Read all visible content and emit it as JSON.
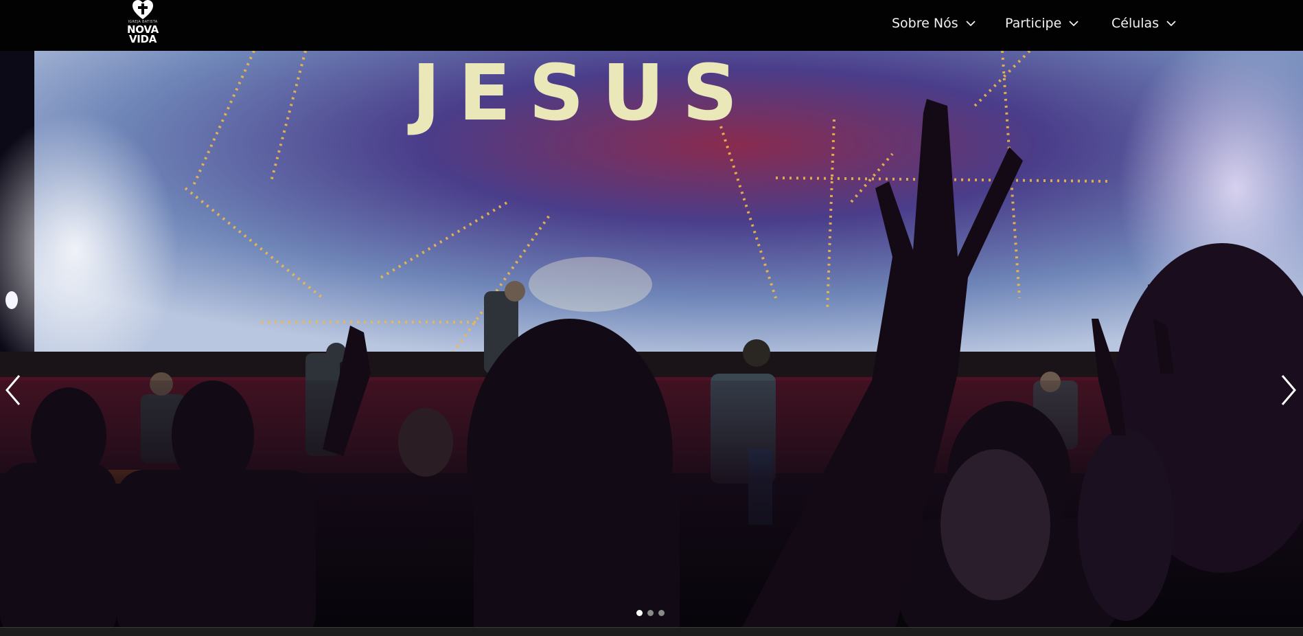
{
  "header": {
    "logo": {
      "tagline": "Igreja Batista",
      "line1": "NOVA",
      "line2": "VIDA"
    },
    "nav": [
      {
        "label": "Sobre Nós"
      },
      {
        "label": "Participe"
      },
      {
        "label": "Células"
      }
    ]
  },
  "hero": {
    "slide_image_text": "JESUS",
    "slide_count": 3,
    "active_slide": 1
  },
  "colors": {
    "header_bg": "#020202",
    "nav_text": "#f2f2f2",
    "dot_active": "#ffffff",
    "dot_inactive": "#8a8a8a"
  },
  "icons": {
    "prev": "chevron-left-icon",
    "next": "chevron-right-icon",
    "dropdown": "chevron-down-icon"
  }
}
